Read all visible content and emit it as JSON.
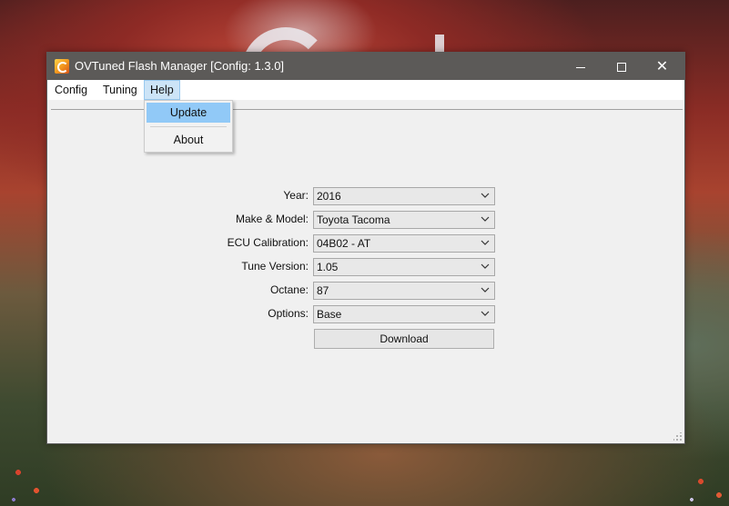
{
  "window": {
    "title": "OVTuned Flash Manager [Config: 1.3.0]",
    "controls": {
      "minimize_icon": "minimize-icon",
      "maximize_icon": "maximize-icon",
      "close_icon": "close-icon"
    }
  },
  "menubar": {
    "items": [
      {
        "label": "Config"
      },
      {
        "label": "Tuning"
      },
      {
        "label": "Help",
        "open": true
      }
    ]
  },
  "help_menu": {
    "items": [
      {
        "label": "Update",
        "highlighted": true
      },
      {
        "label": "About"
      }
    ]
  },
  "form": {
    "fields": [
      {
        "label": "Year:",
        "value": "2016"
      },
      {
        "label": "Make & Model:",
        "value": "Toyota Tacoma"
      },
      {
        "label": "ECU Calibration:",
        "value": "04B02 - AT"
      },
      {
        "label": "Tune Version:",
        "value": "1.05"
      },
      {
        "label": "Octane:",
        "value": "87"
      },
      {
        "label": "Options:",
        "value": "Base"
      }
    ],
    "download_label": "Download"
  },
  "colors": {
    "titlebar": "#5c5a58",
    "menu_highlight": "#91c9f7",
    "window_bg": "#f0f0f0"
  }
}
